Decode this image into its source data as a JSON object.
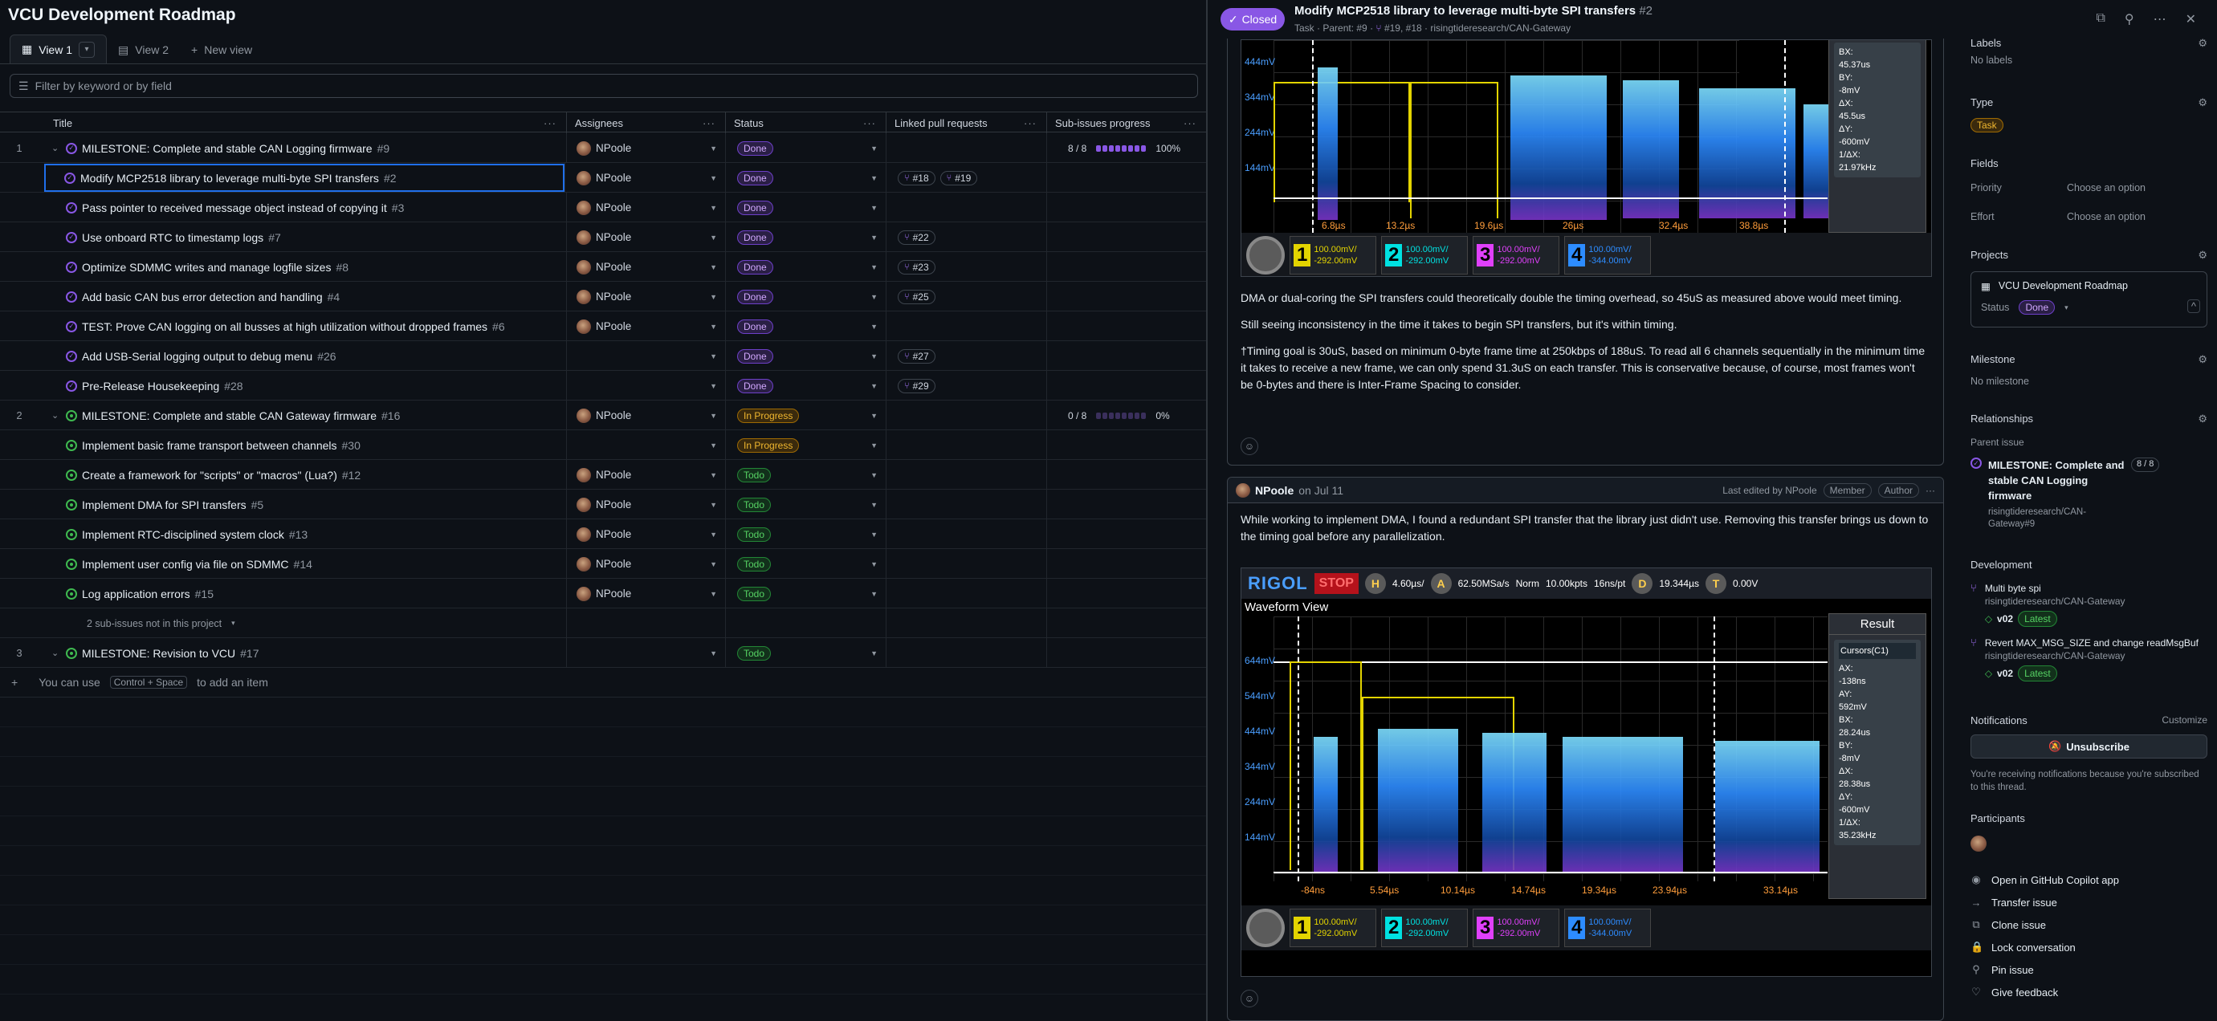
{
  "project": {
    "title": "VCU Development Roadmap"
  },
  "views": [
    {
      "label": "View 1"
    },
    {
      "label": "View 2"
    },
    {
      "label": "New view"
    }
  ],
  "filter": {
    "placeholder": "Filter by keyword or by field"
  },
  "columns": [
    "Title",
    "Assignees",
    "Status",
    "Linked pull requests",
    "Sub-issues progress"
  ],
  "rows": [
    {
      "num": "1",
      "title": "MILESTONE: Complete and stable CAN Logging firmware",
      "ref": "#9",
      "assignee": "NPoole",
      "status": "Done",
      "prs": [],
      "progress": "8 / 8",
      "pct": "100%",
      "done": 8,
      "total": 8
    },
    {
      "title": "Modify MCP2518 library to leverage multi-byte SPI transfers",
      "ref": "#2",
      "assignee": "NPoole",
      "status": "Done",
      "prs": [
        "#18",
        "#19"
      ]
    },
    {
      "title": "Pass pointer to received message object instead of copying it",
      "ref": "#3",
      "assignee": "NPoole",
      "status": "Done",
      "prs": []
    },
    {
      "title": "Use onboard RTC to timestamp logs",
      "ref": "#7",
      "assignee": "NPoole",
      "status": "Done",
      "prs": [
        "#22"
      ]
    },
    {
      "title": "Optimize SDMMC writes and manage logfile sizes",
      "ref": "#8",
      "assignee": "NPoole",
      "status": "Done",
      "prs": [
        "#23"
      ]
    },
    {
      "title": "Add basic CAN bus error detection and handling",
      "ref": "#4",
      "assignee": "NPoole",
      "status": "Done",
      "prs": [
        "#25"
      ]
    },
    {
      "title": "TEST: Prove CAN logging on all busses at high utilization without dropped frames",
      "ref": "#6",
      "assignee": "NPoole",
      "status": "Done",
      "prs": []
    },
    {
      "title": "Add USB-Serial logging output to debug menu",
      "ref": "#26",
      "assignee": "",
      "status": "Done",
      "prs": [
        "#27"
      ]
    },
    {
      "title": "Pre-Release Housekeeping",
      "ref": "#28",
      "assignee": "",
      "status": "Done",
      "prs": [
        "#29"
      ]
    },
    {
      "num": "2",
      "title": "MILESTONE: Complete and stable CAN Gateway firmware",
      "ref": "#16",
      "assignee": "NPoole",
      "status": "In Progress",
      "prs": [],
      "progress": "0 / 8",
      "pct": "0%",
      "done": 0,
      "total": 8
    },
    {
      "title": "Implement basic frame transport between channels",
      "ref": "#30",
      "assignee": "",
      "status": "In Progress",
      "prs": []
    },
    {
      "title": "Create a framework for \"scripts\" or \"macros\" (Lua?)",
      "ref": "#12",
      "assignee": "NPoole",
      "status": "Todo",
      "prs": []
    },
    {
      "title": "Implement DMA for SPI transfers",
      "ref": "#5",
      "assignee": "NPoole",
      "status": "Todo",
      "prs": []
    },
    {
      "title": "Implement RTC-disciplined system clock",
      "ref": "#13",
      "assignee": "NPoole",
      "status": "Todo",
      "prs": []
    },
    {
      "title": "Implement user config via file on SDMMC",
      "ref": "#14",
      "assignee": "NPoole",
      "status": "Todo",
      "prs": []
    },
    {
      "title": "Log application errors",
      "ref": "#15",
      "assignee": "NPoole",
      "status": "Todo",
      "prs": []
    },
    {
      "title": "2 sub-issues not in this project",
      "ref": "",
      "assignee": "",
      "status": "",
      "prs": []
    },
    {
      "num": "3",
      "title": "MILESTONE: Revision to VCU",
      "ref": "#17",
      "assignee": "",
      "status": "Todo",
      "prs": []
    }
  ],
  "add_item": {
    "prefix": "You can use",
    "kbd": "Control + Space",
    "suffix": "to add an item"
  },
  "issue": {
    "state": "Closed",
    "title": "Modify MCP2518 library to leverage multi-byte SPI transfers",
    "number": "#2",
    "meta_type": "Task",
    "meta_parent": "Parent: #9",
    "meta_prs": "#19, #18",
    "meta_repo": "risingtideresearch/CAN-Gateway"
  },
  "comment1": {
    "para1": "DMA or dual-coring the SPI transfers could theoretically double the timing overhead, so 45uS as measured above would meet timing.",
    "para2": "Still seeing inconsistency in the time it takes to begin SPI transfers, but it's within timing.",
    "para3": "†Timing goal is 30uS, based on minimum 0-byte frame time at 250kbps of 188uS. To read all 6 channels sequentially in the minimum time it takes to receive a new frame, we can only spend 31.3uS on each transfer. This is conservative because, of course, most frames won't be 0-bytes and there is Inter-Frame Spacing to consider."
  },
  "scope1": {
    "y_labels": [
      "444mV",
      "344mV",
      "244mV",
      "144mV"
    ],
    "x_labels": [
      "6.8µs",
      "13.2µs",
      "19.6µs",
      "26µs",
      "32.4µs",
      "38.8µs"
    ],
    "result": [
      "BX:",
      "45.37us",
      "BY:",
      "-8mV",
      "ΔX:",
      "45.5us",
      "ΔY:",
      "-600mV",
      "1/ΔX:",
      "21.97kHz"
    ]
  },
  "comment2": {
    "author": "NPoole",
    "date": "on Jul 11",
    "edited": "Last edited by NPoole",
    "badge1": "Member",
    "badge2": "Author",
    "body": "While working to implement DMA, I found a redundant SPI transfer that the library just didn't use. Removing this transfer brings us down to the timing goal before any parallelization."
  },
  "scope2": {
    "brand": "RIGOL",
    "stop": "STOP",
    "timebase": "4.60µs/",
    "sample": "62.50MSa/s",
    "mode": "Norm",
    "points": "10.00kpts",
    "ns": "16ns/pt",
    "delay": "19.344µs",
    "trig": "0.00V",
    "waveform_title": "Waveform View",
    "result_title": "Result",
    "cursor_title": "Cursors(C1)",
    "result": [
      "AX:",
      "-138ns",
      "AY:",
      "592mV",
      "BX:",
      "28.24us",
      "BY:",
      "-8mV",
      "ΔX:",
      "28.38us",
      "ΔY:",
      "-600mV",
      "1/ΔX:",
      "35.23kHz"
    ],
    "y_labels": [
      "644mV",
      "544mV",
      "444mV",
      "344mV",
      "244mV",
      "144mV"
    ],
    "x_labels": [
      "-84ns",
      "5.54µs",
      "10.14µs",
      "14.74µs",
      "19.34µs",
      "23.94µs",
      "33.14µs"
    ],
    "channels": [
      {
        "n": "1",
        "v1": "100.00mV/",
        "v2": "-292.00mV",
        "color": "#e3d400"
      },
      {
        "n": "2",
        "v1": "100.00mV/",
        "v2": "-292.00mV",
        "color": "#00e1e1"
      },
      {
        "n": "3",
        "v1": "100.00mV/",
        "v2": "-292.00mV",
        "color": "#e040fb"
      },
      {
        "n": "4",
        "v1": "100.00mV/",
        "v2": "-344.00mV",
        "color": "#2d8cff"
      }
    ]
  },
  "sidebar": {
    "labels_h": "Labels",
    "labels_v": "No labels",
    "type_h": "Type",
    "type_v": "Task",
    "fields_h": "Fields",
    "priority": "Priority",
    "priority_v": "Choose an option",
    "effort": "Effort",
    "effort_v": "Choose an option",
    "projects_h": "Projects",
    "project_name": "VCU Development Roadmap",
    "status_k": "Status",
    "status_v": "Done",
    "milestone_h": "Milestone",
    "milestone_v": "No milestone",
    "rel_h": "Relationships",
    "parent_h": "Parent issue",
    "parent_title": "MILESTONE: Complete and stable CAN Logging firmware",
    "parent_repo": "risingtideresearch/CAN-Gateway#9",
    "parent_prog": "8 / 8",
    "dev_h": "Development",
    "dev1_title": "Multi byte spi",
    "dev1_repo": "risingtideresearch/CAN-Gateway",
    "dev1_tag": "v02",
    "dev1_latest": "Latest",
    "dev2_title": "Revert MAX_MSG_SIZE and change readMsgBuf",
    "dev2_repo": "risingtideresearch/CAN-Gateway",
    "dev2_tag": "v02",
    "dev2_latest": "Latest",
    "notif_h": "Notifications",
    "customize": "Customize",
    "unsubscribe": "Unsubscribe",
    "notif_text": "You're receiving notifications because you're subscribed to this thread.",
    "part_h": "Participants",
    "actions": [
      "Open in GitHub Copilot app",
      "Transfer issue",
      "Clone issue",
      "Lock conversation",
      "Pin issue",
      "Give feedback"
    ]
  },
  "colors": {
    "done": "#8957e5",
    "progress": "#9e6a03",
    "todo": "#238636",
    "accent": "#1f6feb"
  }
}
